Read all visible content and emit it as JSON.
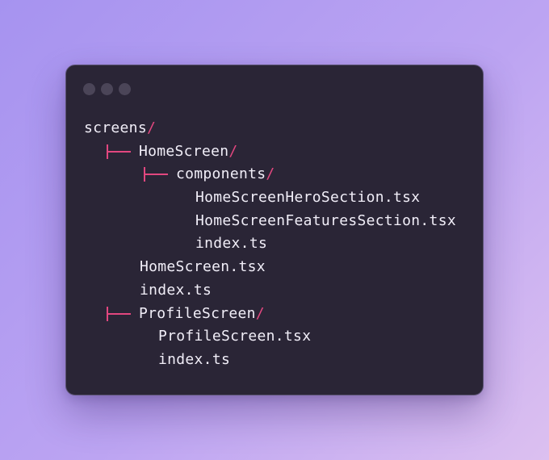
{
  "window": {
    "controls": [
      "close-dot",
      "minimize-dot",
      "maximize-dot"
    ]
  },
  "tree": {
    "root": "screens",
    "home_folder": "HomeScreen",
    "components_folder": "components",
    "hero_section": "HomeScreenHeroSection.tsx",
    "features_section": "HomeScreenFeaturesSection.tsx",
    "components_index": "index.ts",
    "home_file": "HomeScreen.tsx",
    "home_index": "index.ts",
    "profile_folder": "ProfileScreen",
    "profile_file": "ProfileScreen.tsx",
    "profile_index": "index.ts",
    "separator": "/"
  },
  "colors": {
    "accent": "#e2477f",
    "window_bg": "#2a2536",
    "text": "#f1eef8"
  }
}
